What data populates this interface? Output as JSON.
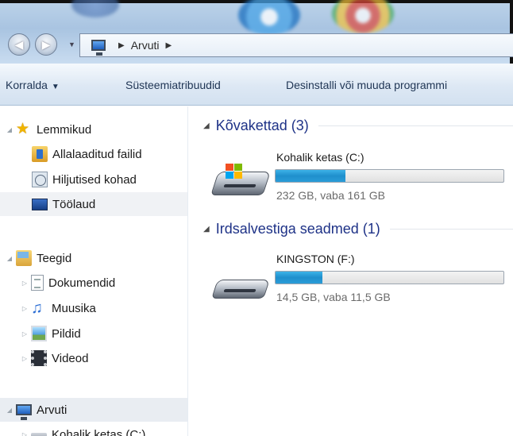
{
  "address": {
    "crumbs": [
      "Arvuti"
    ],
    "icons": {
      "back": "back-arrow-icon",
      "forward": "forward-arrow-icon",
      "computer": "computer-icon"
    }
  },
  "toolbar": {
    "organize_label": "Korralda",
    "properties_label": "Süsteemiatribuudid",
    "uninstall_label": "Desinstalli või muuda programmi"
  },
  "sidebar": {
    "favorites": {
      "label": "Lemmikud",
      "items": [
        {
          "label": "Allalaaditud failid",
          "icon": "downloads-folder-icon"
        },
        {
          "label": "Hiljutised kohad",
          "icon": "recent-places-icon"
        },
        {
          "label": "Töölaud",
          "icon": "desktop-icon",
          "selected": true
        }
      ]
    },
    "libraries": {
      "label": "Teegid",
      "items": [
        {
          "label": "Dokumendid",
          "icon": "documents-icon"
        },
        {
          "label": "Muusika",
          "icon": "music-icon"
        },
        {
          "label": "Pildid",
          "icon": "pictures-icon"
        },
        {
          "label": "Videod",
          "icon": "videos-icon"
        }
      ]
    },
    "computer": {
      "label": "Arvuti",
      "items": [
        {
          "label": "Kohalik ketas (C:)",
          "icon": "local-disk-icon"
        }
      ]
    }
  },
  "main": {
    "groups": [
      {
        "title": "Kõvakettad (3)",
        "drives": [
          {
            "name": "Kohalik ketas (C:)",
            "space": "232 GB, vaba 161 GB",
            "used_fraction": 0.306,
            "icon": "windows-drive-icon"
          }
        ]
      },
      {
        "title": "Irdsalvestiga seadmed (1)",
        "drives": [
          {
            "name": "KINGSTON (F:)",
            "space": "14,5 GB, vaba 11,5 GB",
            "used_fraction": 0.207,
            "icon": "removable-drive-icon"
          }
        ]
      }
    ]
  },
  "colors": {
    "accent": "#1e3287",
    "bar_fill": "#2a9dd8",
    "selected_bg": "#f0f2f5"
  }
}
